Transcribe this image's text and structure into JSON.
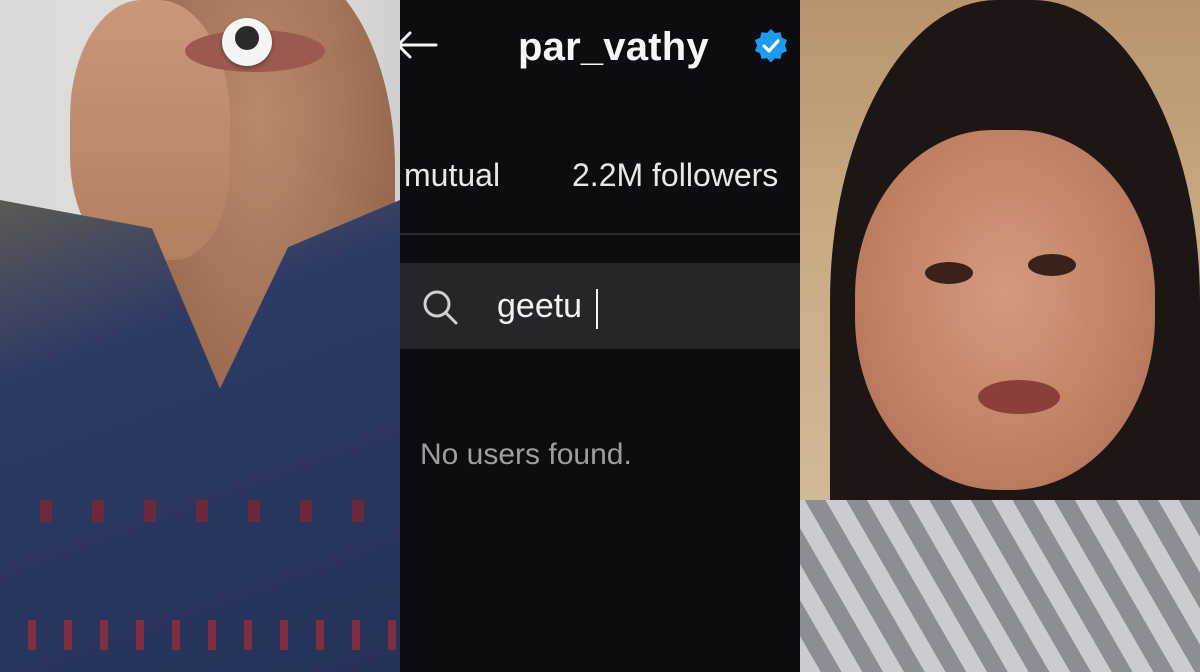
{
  "profile": {
    "username": "par_vathy",
    "verified": true
  },
  "tabs": {
    "mutual_label": "mutual",
    "followers_label": "2.2M followers"
  },
  "search": {
    "value": "geetu",
    "icon": "search-icon"
  },
  "results": {
    "empty_message": "No users found."
  },
  "icons": {
    "back": "back-arrow-icon",
    "verified": "verified-badge-icon"
  },
  "colors": {
    "background": "#0c0d10",
    "search_bar": "#25262a",
    "verified_badge": "#1d9bf0",
    "muted_text": "#9c9ea4"
  }
}
